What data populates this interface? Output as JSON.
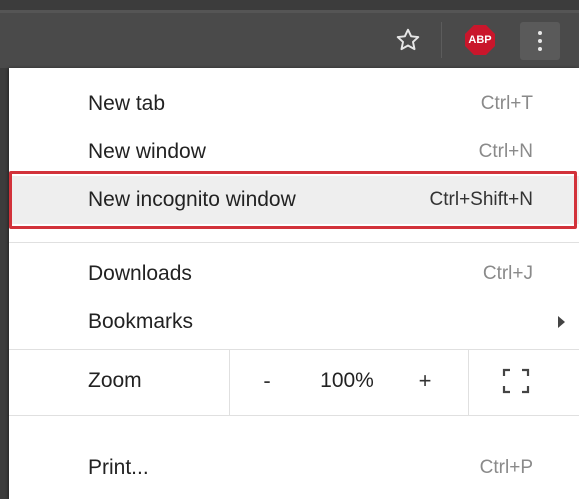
{
  "toolbar": {
    "star_icon": "star-outline-icon",
    "abp_label": "ABP",
    "menu_icon": "vertical-dots-icon"
  },
  "menu": {
    "items": [
      {
        "label": "New tab",
        "shortcut": "Ctrl+T"
      },
      {
        "label": "New window",
        "shortcut": "Ctrl+N"
      },
      {
        "label": "New incognito window",
        "shortcut": "Ctrl+Shift+N"
      },
      {
        "label": "Downloads",
        "shortcut": "Ctrl+J"
      },
      {
        "label": "Bookmarks",
        "shortcut": ""
      },
      {
        "label": "Print...",
        "shortcut": "Ctrl+P"
      }
    ],
    "zoom": {
      "label": "Zoom",
      "minus": "-",
      "value": "100%",
      "plus": "+"
    }
  },
  "colors": {
    "highlight_border": "#d2323a",
    "abp_red": "#c9162b",
    "toolbar_bg": "#4a4a4a"
  }
}
